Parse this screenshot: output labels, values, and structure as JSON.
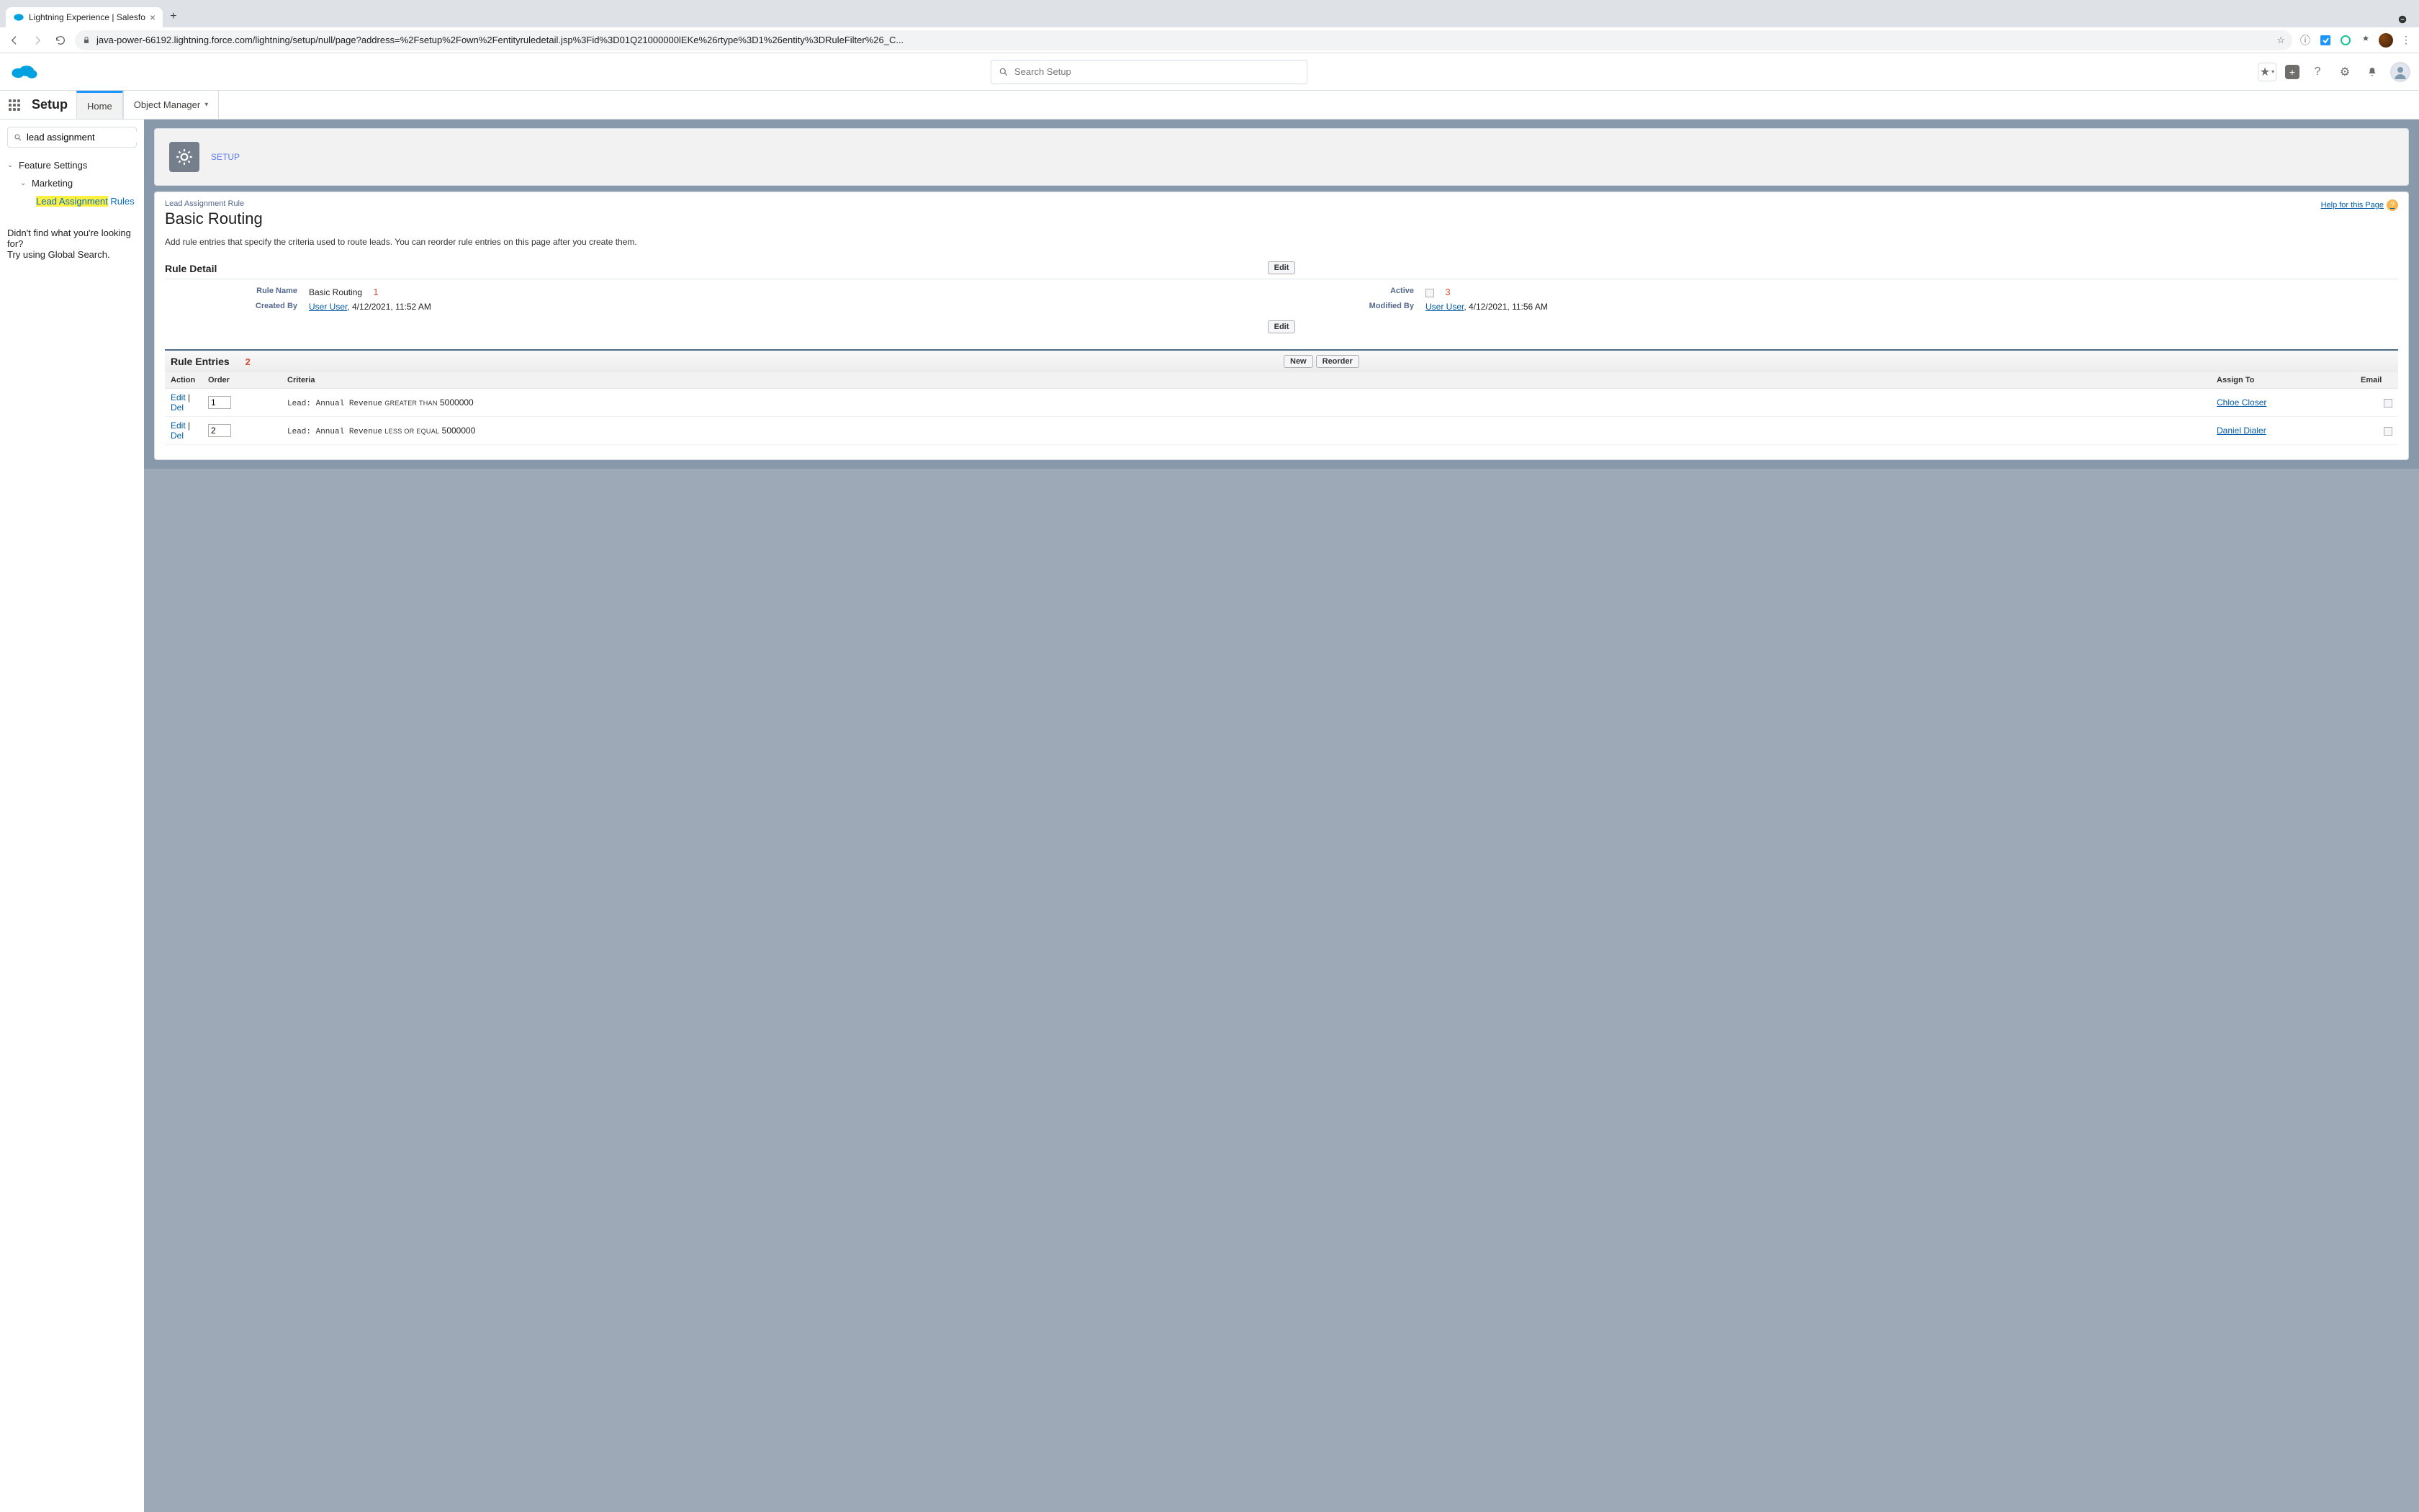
{
  "browser": {
    "tab_title": "Lightning Experience | Salesfo",
    "url": "java-power-66192.lightning.force.com/lightning/setup/null/page?address=%2Fsetup%2Fown%2Fentityruledetail.jsp%3Fid%3D01Q21000000lEKe%26rtype%3D1%26entity%3DRuleFilter%26_C...",
    "newtab_label": "+"
  },
  "sf_header": {
    "search_placeholder": "Search Setup"
  },
  "nav": {
    "app_name": "Setup",
    "tabs": {
      "home": "Home",
      "object_manager": "Object Manager"
    }
  },
  "sidebar": {
    "search_value": "lead assignment",
    "tree": {
      "lvl1": "Feature Settings",
      "lvl2": "Marketing",
      "lvl3_prefix_hl": "Lead Assignment",
      "lvl3_suffix": " Rules"
    },
    "no_results": "Didn't find what you're looking for?\nTry using Global Search."
  },
  "page": {
    "header_crumb": "SETUP",
    "eyebrow": "Lead Assignment Rule",
    "title": "Basic Routing",
    "help_link": "Help for this Page",
    "description": "Add rule entries that specify the criteria used to route leads. You can reorder rule entries on this page after you create them.",
    "rule_detail_title": "Rule Detail",
    "annotations": {
      "a1": "1",
      "a2": "2",
      "a3": "3"
    },
    "edit_btn": "Edit",
    "fields": {
      "rule_name_label": "Rule Name",
      "rule_name_value": "Basic Routing",
      "active_label": "Active",
      "created_by_label": "Created By",
      "created_by_user": "User User",
      "created_by_date": ", 4/12/2021, 11:52 AM",
      "modified_by_label": "Modified By",
      "modified_by_user": "User User",
      "modified_by_date": ", 4/12/2021, 11:56 AM"
    },
    "entries_title": "Rule Entries",
    "new_btn": "New",
    "reorder_btn": "Reorder",
    "columns": {
      "action": "Action",
      "order": "Order",
      "criteria": "Criteria",
      "assign": "Assign To",
      "email": "Email"
    },
    "row_action_edit": "Edit",
    "row_action_del": "Del",
    "rows": [
      {
        "order": "1",
        "field": "Lead: Annual Revenue",
        "op": "GREATER THAN",
        "val": "5000000",
        "assignee": "Chloe Closer"
      },
      {
        "order": "2",
        "field": "Lead: Annual Revenue",
        "op": "LESS OR EQUAL",
        "val": "5000000",
        "assignee": "Daniel Dialer"
      }
    ]
  }
}
